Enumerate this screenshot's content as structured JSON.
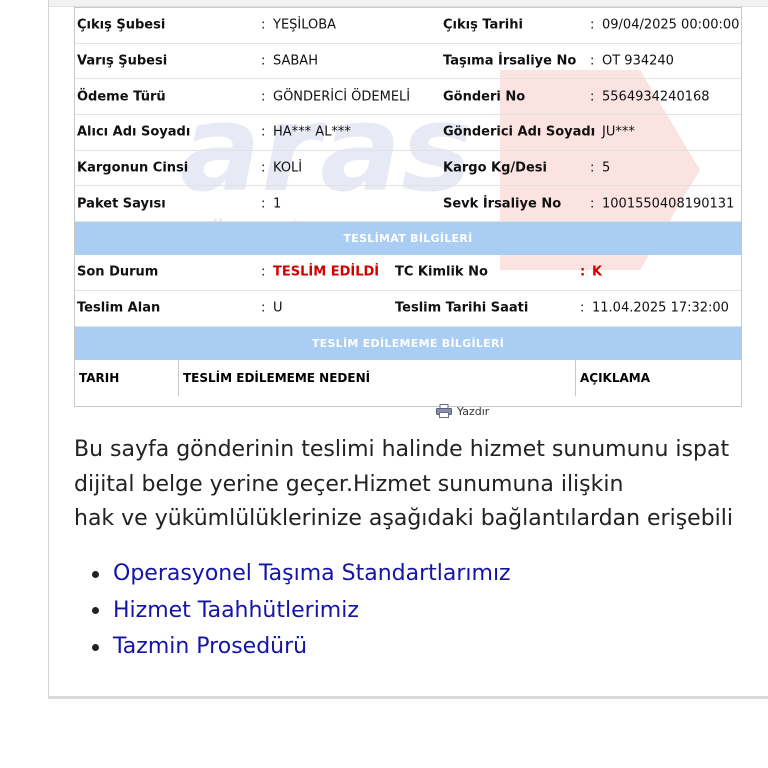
{
  "watermark": {
    "brand": "aras",
    "slogan": "önem taşır"
  },
  "shipment": [
    {
      "l1": "Çıkış Şubesi",
      "v1": "YEŞİLOBA",
      "l2": "Çıkış Tarihi",
      "v2": "09/04/2025 00:00:00"
    },
    {
      "l1": "Varış Şubesi",
      "v1": "SABAH",
      "l2": "Taşıma İrsaliye No",
      "v2": "OT 934240"
    },
    {
      "l1": "Ödeme Türü",
      "v1": "GÖNDERİCİ ÖDEMELİ",
      "l2": "Gönderi No",
      "v2": "5564934240168"
    },
    {
      "l1": "Alıcı Adı Soyadı",
      "v1": "HA*** AL***",
      "l2": "Gönderici Adı Soyadı",
      "v2": "JU***"
    },
    {
      "l1": "Kargonun Cinsi",
      "v1": "KOLİ",
      "l2": "Kargo Kg/Desi",
      "v2": "5"
    },
    {
      "l1": "Paket Sayısı",
      "v1": "1",
      "l2": "Sevk İrsaliye No",
      "v2": "1001550408190131"
    }
  ],
  "delivery": {
    "title": "TESLİMAT BİLGİLERİ",
    "status_label": "Son Durum",
    "status_value": "TESLİM EDİLDİ",
    "tc_label": "TC Kimlik No",
    "tc_value": "K",
    "receiver_label": "Teslim Alan",
    "receiver_value": "U",
    "date_label": "Teslim Tarihi Saati",
    "date_value": "11.04.2025 17:32:00"
  },
  "non_delivery": {
    "title": "TESLİM EDİLEMEME BİLGİLERİ",
    "columns": [
      "TARIH",
      "TESLİM EDİLEMEME NEDENİ",
      "AÇIKLAMA"
    ]
  },
  "separator": ":",
  "print_label": "Yazdır",
  "paragraph": [
    "Bu sayfa gönderinin teslimi halinde hizmet sunumunu ispat",
    "dijital belge yerine geçer.Hizmet sunumuna ilişkin",
    "hak ve yükümlülüklerinize aşağıdaki bağlantılardan erişebili"
  ],
  "links": [
    "Operasyonel Taşıma Standartlarımız",
    "Hizmet Taahhütlerimiz",
    "Tazmin Prosedürü"
  ],
  "colors": {
    "section_header": "#a9cdf3",
    "status_red": "#d40000",
    "link": "#1414a8"
  }
}
